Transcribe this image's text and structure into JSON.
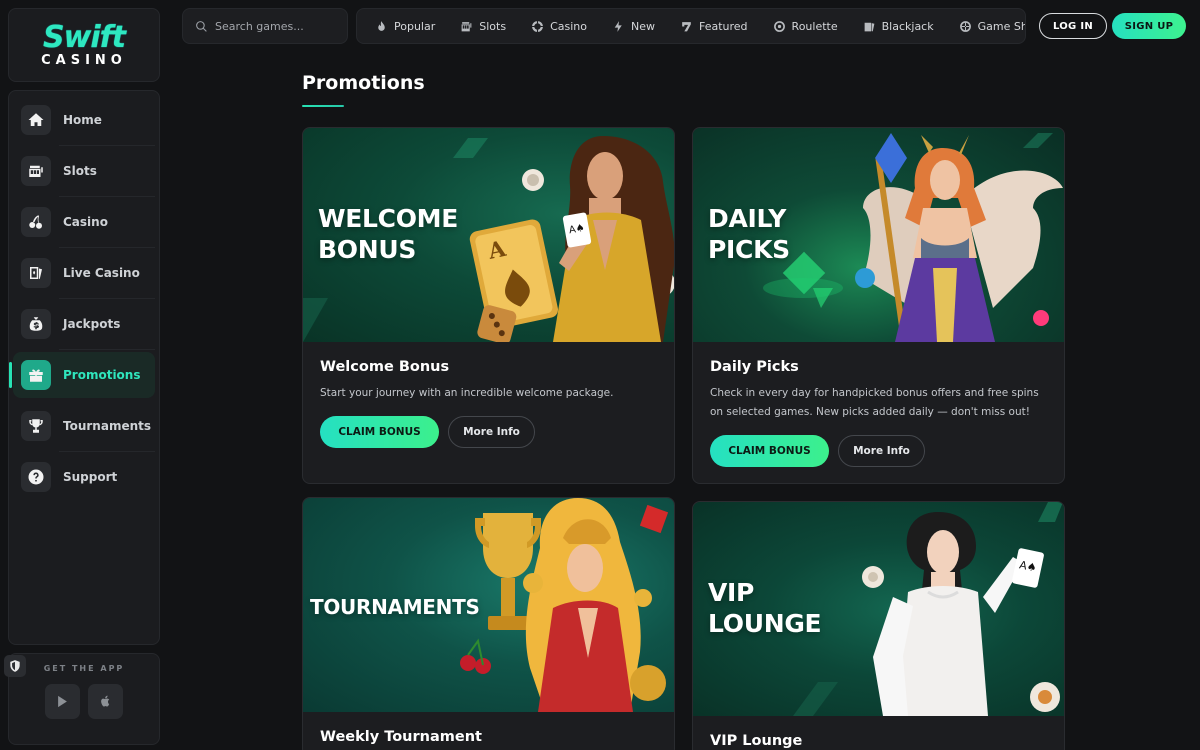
{
  "brand": {
    "logo_top": "Swift",
    "logo_bottom": "CASINO"
  },
  "sidebar": {
    "items": [
      {
        "label": "Home",
        "icon": "home-icon"
      },
      {
        "label": "Slots",
        "icon": "slot-machine-icon"
      },
      {
        "label": "Casino",
        "icon": "cherries-icon"
      },
      {
        "label": "Live Casino",
        "icon": "playing-cards-icon"
      },
      {
        "label": "Jackpots",
        "icon": "money-bag-icon"
      },
      {
        "label": "Promotions",
        "icon": "gift-icon",
        "active": true
      },
      {
        "label": "Tournaments",
        "icon": "trophy-icon"
      },
      {
        "label": "Support",
        "icon": "question-icon"
      }
    ],
    "app": {
      "title": "GET THE APP",
      "stores": [
        "google-play-icon",
        "apple-icon"
      ]
    }
  },
  "topbar": {
    "search_placeholder": "Search games...",
    "categories": [
      {
        "label": "Popular",
        "icon": "flame-icon"
      },
      {
        "label": "Slots",
        "icon": "slot-machine-icon"
      },
      {
        "label": "Casino",
        "icon": "chip-icon"
      },
      {
        "label": "New",
        "icon": "lightning-icon"
      },
      {
        "label": "Featured",
        "icon": "seven-icon"
      },
      {
        "label": "Roulette",
        "icon": "roulette-icon"
      },
      {
        "label": "Blackjack",
        "icon": "cards-icon"
      },
      {
        "label": "Game Shows",
        "icon": "wheel-icon"
      }
    ],
    "login_label": "LOG IN",
    "signup_label": "SIGN UP"
  },
  "main": {
    "title": "Promotions",
    "promotions": [
      {
        "banner_line1": "WELCOME",
        "banner_line2": "BONUS",
        "title": "Welcome Bonus",
        "description": "Start your journey with an incredible welcome package.",
        "claim_label": "CLAIM BONUS",
        "more_label": "More Info"
      },
      {
        "banner_line1": "DAILY",
        "banner_line2": "PICKS",
        "title": "Daily Picks",
        "description": "Check in every day for handpicked bonus offers and free spins on selected games. New picks added daily — don't miss out!",
        "claim_label": "CLAIM BONUS",
        "more_label": "More Info"
      },
      {
        "banner_line1": "TOURNAMENTS",
        "banner_line2": "",
        "title": "Weekly Tournament"
      },
      {
        "banner_line1": "VIP",
        "banner_line2": "LOUNGE",
        "title": "VIP Lounge"
      }
    ]
  },
  "colors": {
    "background": "#121315",
    "panel": "#1b1c1f",
    "accent": "#27e3b4",
    "banner_green": "#0d4a38"
  }
}
